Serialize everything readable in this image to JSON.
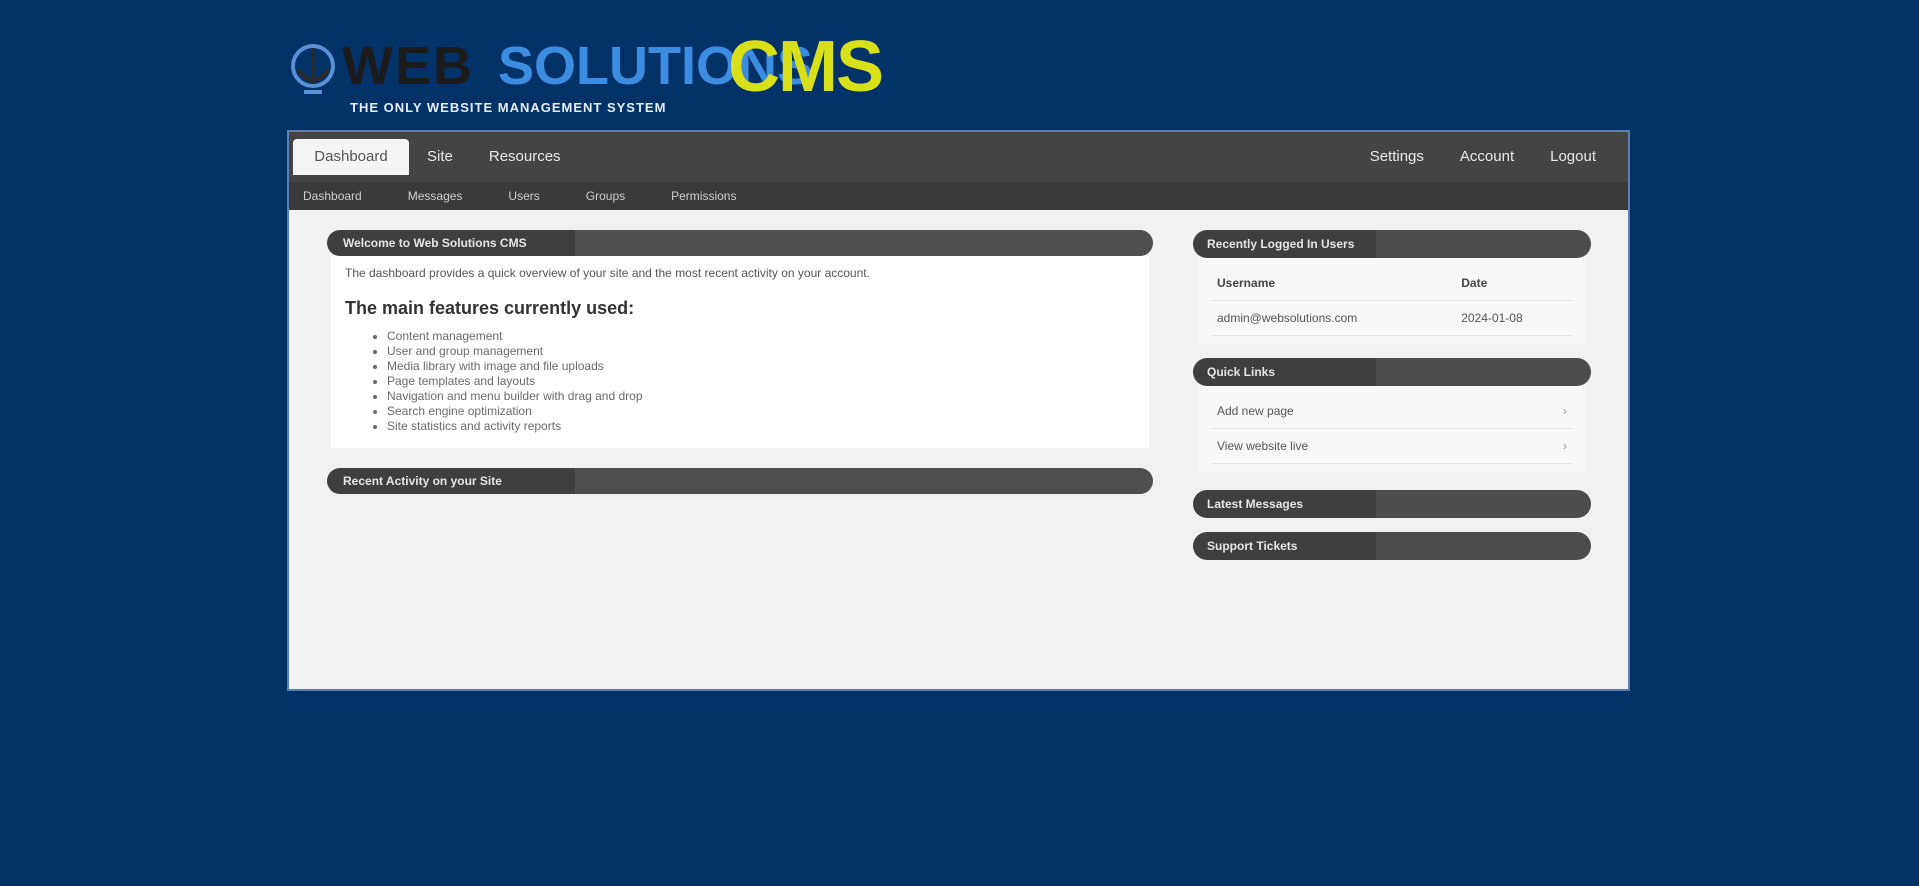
{
  "logo": {
    "word1": "WEB",
    "word2": "SOLUTIONS",
    "word3": "CMS",
    "tagline": "THE ONLY WEBSITE MANAGEMENT SYSTEM"
  },
  "topnav": {
    "left": [
      {
        "label": "Dashboard",
        "active": true
      },
      {
        "label": "Site",
        "active": false
      },
      {
        "label": "Resources",
        "active": false
      }
    ],
    "right": [
      {
        "label": "Settings"
      },
      {
        "label": "Account"
      },
      {
        "label": "Logout"
      }
    ]
  },
  "subnav": [
    "Dashboard",
    "Messages",
    "Users",
    "Groups",
    "Permissions"
  ],
  "main": {
    "welcome_panel": {
      "title": "Welcome to Web Solutions CMS",
      "intro": "The dashboard provides a quick overview of your site and the most recent activity on your account.",
      "features_heading": "The main features currently used:",
      "features": [
        "Content management",
        "User and group management",
        "Media library with image and file uploads",
        "Page templates and layouts",
        "Navigation and menu builder with drag and drop",
        "Search engine optimization",
        "Site statistics and activity reports"
      ]
    },
    "activity_panel": {
      "title": "Recent Activity on your Site"
    }
  },
  "sidebar": {
    "users_block": {
      "title": "Recently Logged In Users",
      "columns": [
        "Username",
        "Date"
      ],
      "rows": [
        [
          "admin@websolutions.com",
          "2024-01-08"
        ]
      ]
    },
    "links_block": {
      "title": "Quick Links",
      "items": [
        "Add new page",
        "View website live"
      ]
    },
    "block3": {
      "title": "Latest Messages"
    },
    "block4": {
      "title": "Support Tickets"
    }
  }
}
